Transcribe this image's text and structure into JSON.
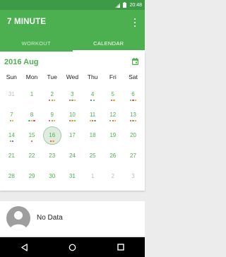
{
  "status_bar": {
    "time": "20:48"
  },
  "app_bar": {
    "title": "7 MINUTE"
  },
  "tabs": [
    {
      "label": "WORKOUT",
      "active": false
    },
    {
      "label": "CALENDAR",
      "active": true
    }
  ],
  "calendar": {
    "month_label": "2016 Aug",
    "weekdays": [
      "Sun",
      "Mon",
      "Tue",
      "Wed",
      "Thu",
      "Fri",
      "Sat"
    ],
    "weeks": [
      [
        {
          "day": "31",
          "muted": true,
          "dots": []
        },
        {
          "day": "1",
          "dots": []
        },
        {
          "day": "2",
          "dots": [
            "#e53935",
            "#4caf50",
            "#ff9800"
          ]
        },
        {
          "day": "3",
          "dots": [
            "#e53935",
            "#4caf50",
            "#ff9800"
          ]
        },
        {
          "day": "4",
          "dots": [
            "#3f51b5",
            "#4caf50"
          ]
        },
        {
          "day": "5",
          "dots": [
            "#e53935",
            "#ff9800"
          ]
        },
        {
          "day": "6",
          "dots": [
            "#4caf50",
            "#e53935",
            "#ff9800"
          ]
        }
      ],
      [
        {
          "day": "7",
          "dots": [
            "#4caf50",
            "#ff9800"
          ]
        },
        {
          "day": "8",
          "dots": [
            "#4caf50",
            "#ff9800",
            "#e53935"
          ]
        },
        {
          "day": "9",
          "dots": [
            "#e53935",
            "#4caf50",
            "#ff9800"
          ]
        },
        {
          "day": "10",
          "dots": [
            "#e53935",
            "#ff9800",
            "#4caf50"
          ]
        },
        {
          "day": "11",
          "dots": [
            "#ff9800",
            "#e53935",
            "#4caf50"
          ]
        },
        {
          "day": "12",
          "dots": [
            "#4caf50",
            "#e53935",
            "#ff9800"
          ]
        },
        {
          "day": "13",
          "dots": [
            "#e53935",
            "#4caf50",
            "#ff9800"
          ]
        }
      ],
      [
        {
          "day": "14",
          "dots": [
            "#4caf50",
            "#3f51b5"
          ]
        },
        {
          "day": "15",
          "dots": [
            "#e53935"
          ]
        },
        {
          "day": "16",
          "today": true,
          "dots": [
            "#e53935",
            "#ff9800"
          ]
        },
        {
          "day": "17",
          "dots": []
        },
        {
          "day": "18",
          "dots": []
        },
        {
          "day": "19",
          "dots": []
        },
        {
          "day": "20",
          "dots": []
        }
      ],
      [
        {
          "day": "21",
          "dots": []
        },
        {
          "day": "22",
          "dots": []
        },
        {
          "day": "23",
          "dots": []
        },
        {
          "day": "24",
          "dots": []
        },
        {
          "day": "25",
          "dots": []
        },
        {
          "day": "26",
          "dots": []
        },
        {
          "day": "27",
          "dots": []
        }
      ],
      [
        {
          "day": "28",
          "dots": []
        },
        {
          "day": "29",
          "dots": []
        },
        {
          "day": "30",
          "dots": []
        },
        {
          "day": "31",
          "dots": []
        },
        {
          "day": "1",
          "muted": true,
          "dots": []
        },
        {
          "day": "2",
          "muted": true,
          "dots": []
        },
        {
          "day": "3",
          "muted": true,
          "dots": []
        }
      ]
    ]
  },
  "detail": {
    "text": "No Data"
  },
  "nav_icons": [
    "back-icon",
    "home-icon",
    "recents-icon"
  ]
}
